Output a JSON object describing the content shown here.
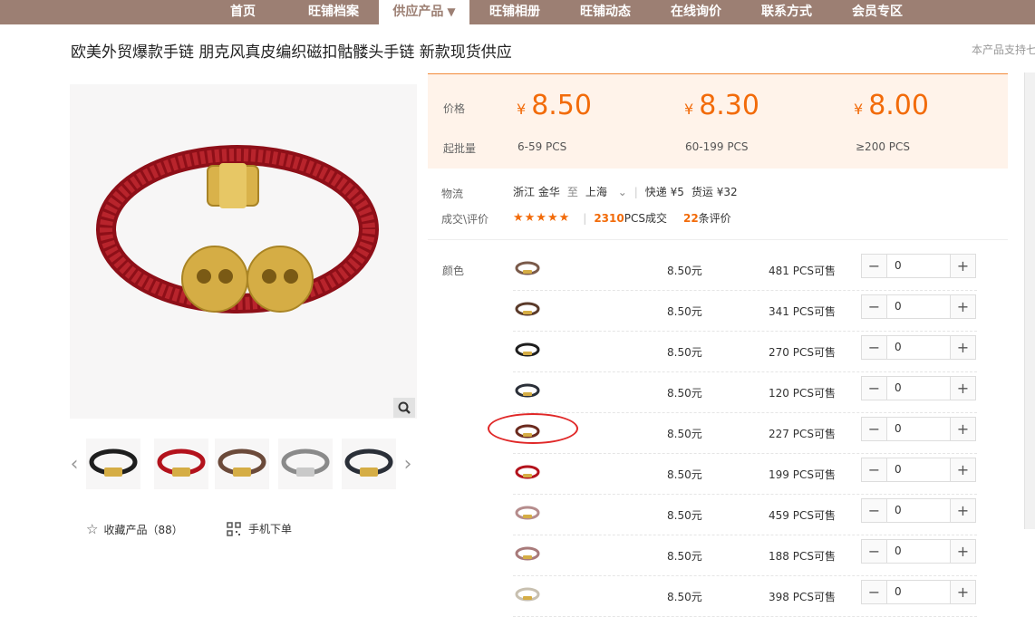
{
  "nav": {
    "items": [
      {
        "label": "首页"
      },
      {
        "label": "旺铺档案"
      },
      {
        "label": "供应产品"
      },
      {
        "label": "旺铺相册"
      },
      {
        "label": "旺铺动态"
      },
      {
        "label": "在线询价"
      },
      {
        "label": "联系方式"
      },
      {
        "label": "会员专区"
      }
    ],
    "active_caret": "▼"
  },
  "product": {
    "title": "欧美外贸爆款手链 朋克风真皮编织磁扣骷髅头手链 新款现货供应",
    "support_text": "本产品支持七"
  },
  "gallery": {
    "fav_label": "收藏产品（88）",
    "mobile_label": "手机下单",
    "thumb_colors": [
      "#1e1e1e",
      "#b3121c",
      "#6b4a3a",
      "#8a8a8a",
      "#2a2f38"
    ]
  },
  "pricing": {
    "price_label": "价格",
    "moq_label": "起批量",
    "currency": "¥",
    "tiers": [
      {
        "price": "8.50",
        "qty": "6-59  PCS"
      },
      {
        "price": "8.30",
        "qty": "60-199  PCS"
      },
      {
        "price": "8.00",
        "qty": "≥200  PCS"
      }
    ]
  },
  "logistics": {
    "label": "物流",
    "from": "浙江 金华",
    "to_word": "至",
    "to": "上海",
    "express": "快递 ¥5",
    "freight": "货运 ¥32"
  },
  "reviews": {
    "label": "成交\\评价",
    "stars": "★★★★★",
    "deals_count": "2310",
    "deals_suffix": "PCS成交",
    "review_count": "22",
    "review_suffix": "条评价"
  },
  "sku": {
    "color_label": "颜色",
    "rows": [
      {
        "price": "8.50元",
        "stock": "481 PCS可售",
        "qty": "0",
        "color": "#7a5a4a"
      },
      {
        "price": "8.50元",
        "stock": "341 PCS可售",
        "qty": "0",
        "color": "#5a3a2a"
      },
      {
        "price": "8.50元",
        "stock": "270 PCS可售",
        "qty": "0",
        "color": "#1e1e1e"
      },
      {
        "price": "8.50元",
        "stock": "120 PCS可售",
        "qty": "0",
        "color": "#2a2f38"
      },
      {
        "price": "8.50元",
        "stock": "227 PCS可售",
        "qty": "0",
        "color": "#6b2a1e"
      },
      {
        "price": "8.50元",
        "stock": "199 PCS可售",
        "qty": "0",
        "color": "#b3121c"
      },
      {
        "price": "8.50元",
        "stock": "459 PCS可售",
        "qty": "0",
        "color": "#b58c8c"
      },
      {
        "price": "8.50元",
        "stock": "188 PCS可售",
        "qty": "0",
        "color": "#a87a7a"
      },
      {
        "price": "8.50元",
        "stock": "398 PCS可售",
        "qty": "0",
        "color": "#c8c0b0"
      }
    ]
  }
}
